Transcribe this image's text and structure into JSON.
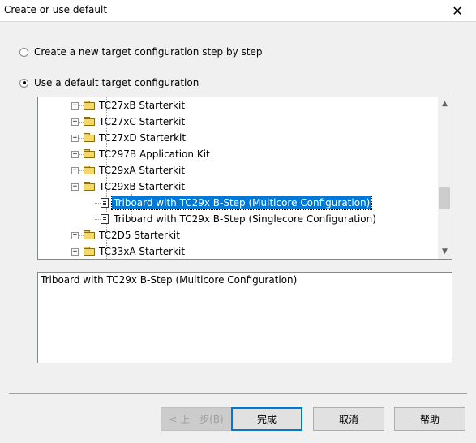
{
  "window": {
    "title": "Create or use default",
    "close_glyph": "✕"
  },
  "options": {
    "step_by_step": {
      "label": "Create a new target configuration step by step",
      "checked": false
    },
    "use_default": {
      "label": "Use a default target configuration",
      "checked": true
    }
  },
  "tree": {
    "items": [
      {
        "label": "TC27xB Starterkit",
        "type": "folder",
        "expander": "+",
        "selected": false
      },
      {
        "label": "TC27xC Starterkit",
        "type": "folder",
        "expander": "+",
        "selected": false
      },
      {
        "label": "TC27xD Starterkit",
        "type": "folder",
        "expander": "+",
        "selected": false
      },
      {
        "label": "TC297B Application Kit",
        "type": "folder",
        "expander": "+",
        "selected": false
      },
      {
        "label": "TC29xA Starterkit",
        "type": "folder",
        "expander": "+",
        "selected": false
      },
      {
        "label": "TC29xB Starterkit",
        "type": "folder",
        "expander": "−",
        "selected": false
      },
      {
        "label": "Triboard with TC29x B-Step (Multicore Configuration)",
        "type": "file",
        "expander": "",
        "selected": true
      },
      {
        "label": "Triboard with TC29x B-Step (Singlecore Configuration)",
        "type": "file",
        "expander": "",
        "selected": false
      },
      {
        "label": "TC2D5 Starterkit",
        "type": "folder",
        "expander": "+",
        "selected": false
      },
      {
        "label": "TC33xA Starterkit",
        "type": "folder",
        "expander": "+",
        "selected": false
      }
    ],
    "scroll_up": "▲",
    "scroll_down": "▼"
  },
  "description": {
    "text": "Triboard with TC29x B-Step (Multicore Configuration)"
  },
  "buttons": {
    "back": "< 上一步(B)",
    "finish": "完成",
    "cancel": "取消",
    "help": "帮助"
  },
  "colors": {
    "selection": "#0078d7",
    "folder": "#f5d86a",
    "dialog_bg": "#f0f0f0"
  }
}
